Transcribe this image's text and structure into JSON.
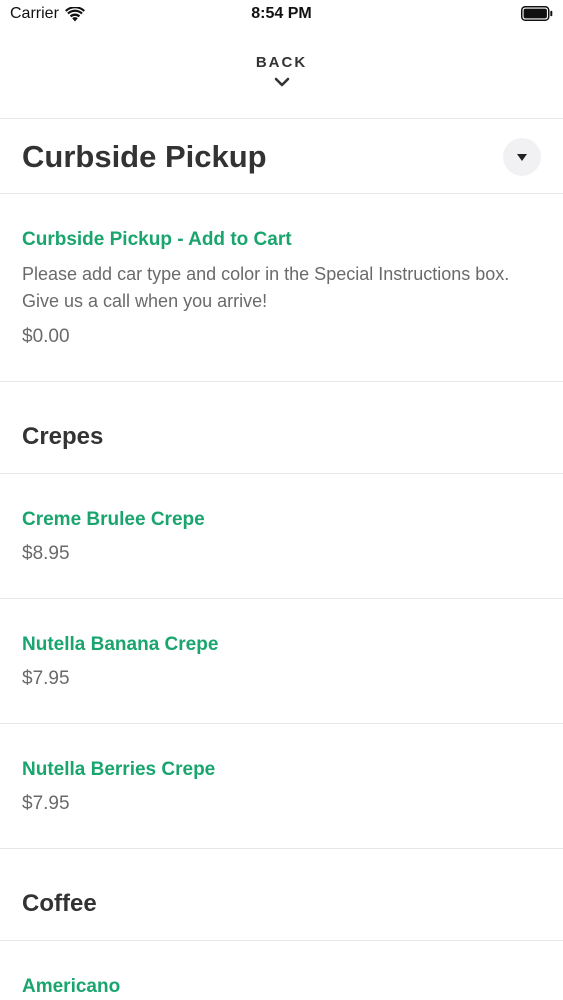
{
  "status_bar": {
    "carrier": "Carrier",
    "time": "8:54 PM",
    "icons": [
      "wifi-icon",
      "battery-icon"
    ]
  },
  "nav": {
    "back_label": "BACK",
    "back_icon": "chevron-down-icon"
  },
  "section": {
    "title": "Curbside Pickup",
    "dropdown_icon": "caret-down-icon"
  },
  "curbside_item": {
    "name": "Curbside Pickup - Add to Cart",
    "description": "Please add car type and color in the Special Instructions box. Give us a call when you arrive!",
    "price": "$0.00"
  },
  "categories": [
    {
      "title": "Crepes",
      "items": [
        {
          "name": "Creme Brulee Crepe",
          "price": "$8.95"
        },
        {
          "name": "Nutella Banana Crepe",
          "price": "$7.95"
        },
        {
          "name": "Nutella Berries Crepe",
          "price": "$7.95"
        }
      ]
    },
    {
      "title": "Coffee",
      "items": [
        {
          "name": "Americano",
          "price": ""
        }
      ]
    }
  ],
  "colors": {
    "accent": "#1aa56f",
    "text": "#333333",
    "muted": "#6a6a6a",
    "divider": "#e6e6e6"
  }
}
